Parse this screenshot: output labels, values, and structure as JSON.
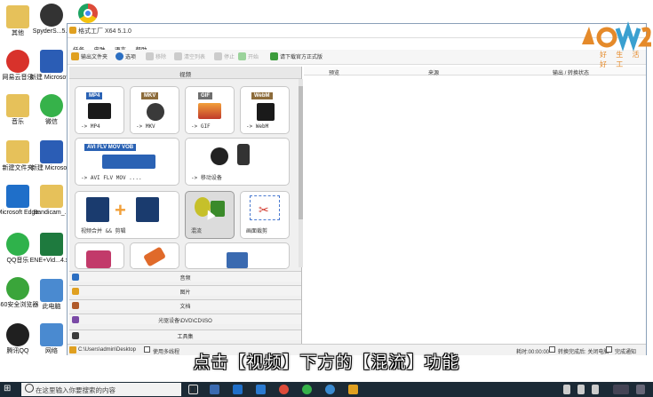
{
  "desktop": {
    "col1": [
      {
        "label": "其他",
        "color": "#e6c15a"
      },
      {
        "label": "网易云音乐",
        "color": "#d8322b"
      },
      {
        "label": "音乐",
        "color": "#e6c15a"
      },
      {
        "label": "新建文件夹",
        "color": "#e6c15a"
      },
      {
        "label": "Microsoft Edge",
        "color": "#1f6fc9"
      },
      {
        "label": "QQ音乐",
        "color": "#2fb24b"
      },
      {
        "label": "360安全浏览器",
        "color": "#3aa53a"
      },
      {
        "label": "腾讯QQ",
        "color": "#202020"
      }
    ],
    "col2": [
      {
        "label": "SpyderS...5.2",
        "color": "#333333"
      },
      {
        "label": "新建 Microsof...",
        "color": "#2b5db5"
      },
      {
        "label": "微信",
        "color": "#36b24a"
      },
      {
        "label": "新建 Microso...",
        "color": "#2b5db5"
      },
      {
        "label": "Bandicam_...",
        "color": "#e6c15a"
      },
      {
        "label": "ENE+Vid...4.xls",
        "color": "#1e7a3e"
      },
      {
        "label": "此电脑",
        "color": "#4a8ad0"
      },
      {
        "label": "网络",
        "color": "#4a8ad0"
      }
    ],
    "chrome_color": "#dd4b39"
  },
  "app": {
    "title": "格式工厂 X64 5.1.0",
    "menu": [
      "任务",
      "皮肤",
      "语言",
      "帮助"
    ],
    "toolbar": [
      {
        "label": "输出文件夹",
        "disabled": false,
        "color": "#e0a020"
      },
      {
        "label": "选项",
        "disabled": false,
        "color": "#2c6fc2"
      },
      {
        "label": "移除",
        "disabled": true,
        "color": "#bbbbbb"
      },
      {
        "label": "清空列表",
        "disabled": true,
        "color": "#bbbbbb"
      },
      {
        "label": "停止",
        "disabled": true,
        "color": "#bbbbbb"
      },
      {
        "label": "开始",
        "disabled": true,
        "color": "#9bd39b"
      },
      {
        "label": "请下载官方正式版",
        "disabled": false,
        "color": "#3c9c3c"
      }
    ],
    "left": {
      "video_header": "视频",
      "tiles": [
        {
          "label": "-> MP4",
          "tag": "MP4",
          "tag_color": "#2a62b4"
        },
        {
          "label": "-> MKV",
          "tag": "MKV",
          "tag_color": "#8c6b3a"
        },
        {
          "label": "-> GIF",
          "tag": "GIF",
          "tag_color": "#6e6e6e"
        },
        {
          "label": "-> WebM",
          "tag": "WebM",
          "tag_color": "#8c6b3a"
        },
        {
          "label": "-> AVI FLV MOV ....",
          "tag": "AVI FLV MOV VOB",
          "tag_color": "#2a62b4"
        },
        {
          "label": "-> 移动设备",
          "tag": "",
          "tag_color": "#333333"
        },
        {
          "label": "视频合并 && 剪辑",
          "tag": "",
          "tag_color": "#1a3b6e"
        },
        {
          "label": "混流",
          "tag": "",
          "tag_color": "#3a8a2a"
        },
        {
          "label": "画面裁剪",
          "tag": "",
          "tag_color": "#d23b2f"
        }
      ],
      "categories": [
        {
          "label": "音频",
          "color": "#2c6fc2"
        },
        {
          "label": "图片",
          "color": "#e0a020"
        },
        {
          "label": "文档",
          "color": "#b05a2a"
        },
        {
          "label": "光驱设备\\DVD\\CD\\ISO",
          "color": "#7a4aa6"
        },
        {
          "label": "工具集",
          "color": "#3a3a3a"
        }
      ]
    },
    "right": {
      "columns": [
        "预览",
        "来源",
        "输出 / 转换状态"
      ]
    },
    "status": {
      "path": "C:\\Users\\admin\\Desktop",
      "multithread": "使用多线程",
      "elapsed": "耗时:00:00:00",
      "after_convert": "转换完成后: 关闭电脑",
      "notify": "完成通知"
    }
  },
  "logo": {
    "text": "好 生 活 好 工",
    "color": "#e58a2a"
  },
  "subtitle": "点击【视频】下方的【混流】功能",
  "taskbar": {
    "search_placeholder": "在这里输入你要搜索的内容",
    "bg_color": "#1b2a36"
  }
}
